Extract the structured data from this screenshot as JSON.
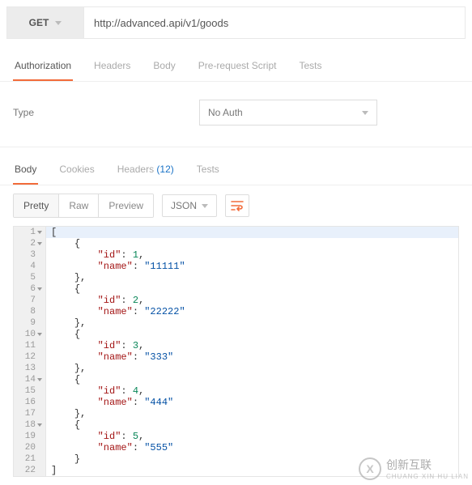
{
  "request": {
    "method": "GET",
    "url": "http://advanced.api/v1/goods"
  },
  "req_tabs": {
    "authorization": "Authorization",
    "headers": "Headers",
    "body": "Body",
    "prerequest": "Pre-request Script",
    "tests": "Tests"
  },
  "auth": {
    "type_label": "Type",
    "selected": "No Auth"
  },
  "resp_tabs": {
    "body": "Body",
    "cookies": "Cookies",
    "headers": "Headers",
    "headers_count": "(12)",
    "tests": "Tests"
  },
  "viewbar": {
    "pretty": "Pretty",
    "raw": "Raw",
    "preview": "Preview",
    "format": "JSON"
  },
  "code": {
    "lines": [
      "[",
      "    {",
      "        \"id\": 1,",
      "        \"name\": \"11111\"",
      "    },",
      "    {",
      "        \"id\": 2,",
      "        \"name\": \"22222\"",
      "    },",
      "    {",
      "        \"id\": 3,",
      "        \"name\": \"333\"",
      "    },",
      "    {",
      "        \"id\": 4,",
      "        \"name\": \"444\"",
      "    },",
      "    {",
      "        \"id\": 5,",
      "        \"name\": \"555\"",
      "    }",
      "]"
    ],
    "fold_lines": [
      1,
      2,
      6,
      10,
      14,
      18
    ]
  },
  "response_data": [
    {
      "id": 1,
      "name": "11111"
    },
    {
      "id": 2,
      "name": "22222"
    },
    {
      "id": 3,
      "name": "333"
    },
    {
      "id": 4,
      "name": "444"
    },
    {
      "id": 5,
      "name": "555"
    }
  ],
  "watermark": {
    "mark": "X",
    "text": "创新互联",
    "sub": "CHUANG XIN HU LIAN"
  }
}
